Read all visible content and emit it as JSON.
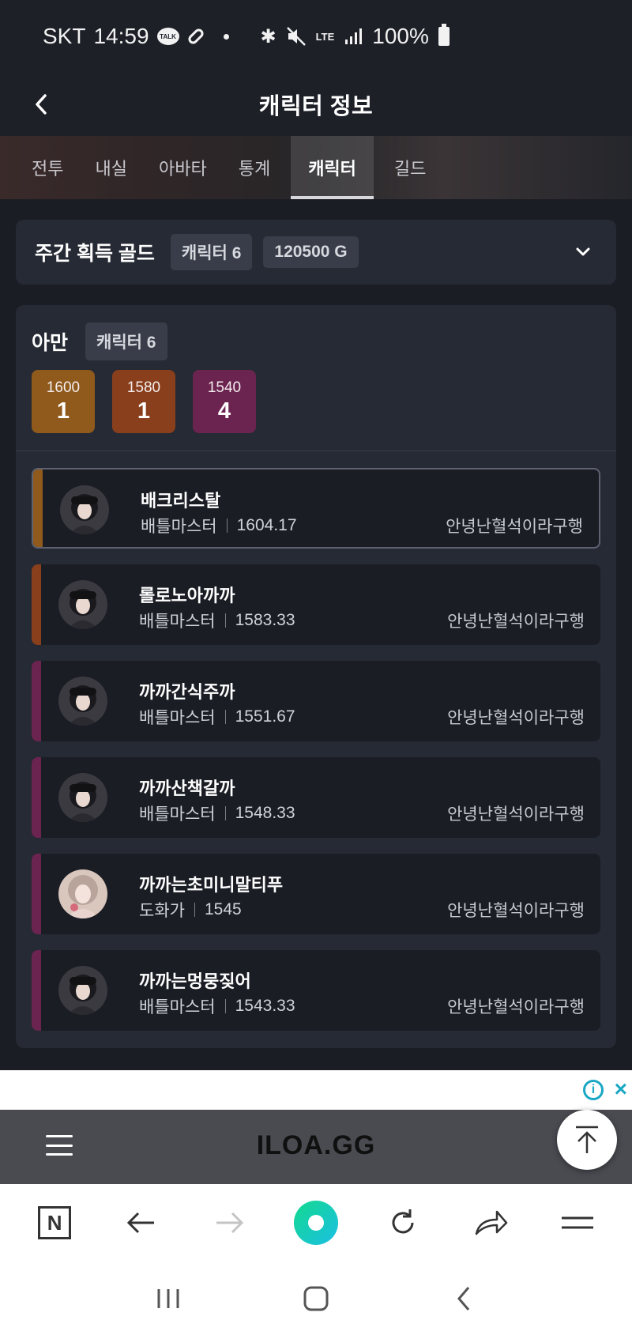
{
  "status_bar": {
    "carrier": "SKT",
    "time": "14:59",
    "talk_icon_label": "TALK",
    "network": "LTE",
    "battery": "100%"
  },
  "header": {
    "title": "캐릭터 정보"
  },
  "tabs": [
    {
      "label": "전투",
      "active": false
    },
    {
      "label": "내실",
      "active": false
    },
    {
      "label": "아바타",
      "active": false
    },
    {
      "label": "통계",
      "active": false
    },
    {
      "label": "캐릭터",
      "active": true
    },
    {
      "label": "길드",
      "active": false
    }
  ],
  "gold_summary": {
    "title": "주간 획득 골드",
    "character_chip": "캐릭터 6",
    "gold_chip": "120500 G"
  },
  "server": {
    "name": "아만",
    "character_chip": "캐릭터 6",
    "levels": [
      {
        "level": "1600",
        "count": "1",
        "color": "#8f5a1c"
      },
      {
        "level": "1580",
        "count": "1",
        "color": "#8a3f1c"
      },
      {
        "level": "1540",
        "count": "4",
        "color": "#6b2450"
      }
    ]
  },
  "characters": [
    {
      "name": "배크리스탈",
      "class": "배틀마스터",
      "item_level": "1604.17",
      "guild": "안녕난혈석이라구행",
      "accent": "#8f5a1c",
      "avatar": "battlemaster"
    },
    {
      "name": "롤로노아까까",
      "class": "배틀마스터",
      "item_level": "1583.33",
      "guild": "안녕난혈석이라구행",
      "accent": "#8a3f1c",
      "avatar": "battlemaster"
    },
    {
      "name": "까까간식주까",
      "class": "배틀마스터",
      "item_level": "1551.67",
      "guild": "안녕난혈석이라구행",
      "accent": "#6b2450",
      "avatar": "battlemaster"
    },
    {
      "name": "까까산책갈까",
      "class": "배틀마스터",
      "item_level": "1548.33",
      "guild": "안녕난혈석이라구행",
      "accent": "#6b2450",
      "avatar": "battlemaster"
    },
    {
      "name": "까까는초미니말티푸",
      "class": "도화가",
      "item_level": "1545",
      "guild": "안녕난혈석이라구행",
      "accent": "#6b2450",
      "avatar": "artist"
    },
    {
      "name": "까까는멍뭉짖어",
      "class": "배틀마스터",
      "item_level": "1543.33",
      "guild": "안녕난혈석이라구행",
      "accent": "#6b2450",
      "avatar": "battlemaster"
    }
  ],
  "site": {
    "logo": "ILOA.GG"
  },
  "browser": {
    "n_label": "N"
  },
  "colors": {
    "background": "#1b1d24",
    "card": "#262a34",
    "chip": "#383d49",
    "brand_green": "#13d98e"
  }
}
